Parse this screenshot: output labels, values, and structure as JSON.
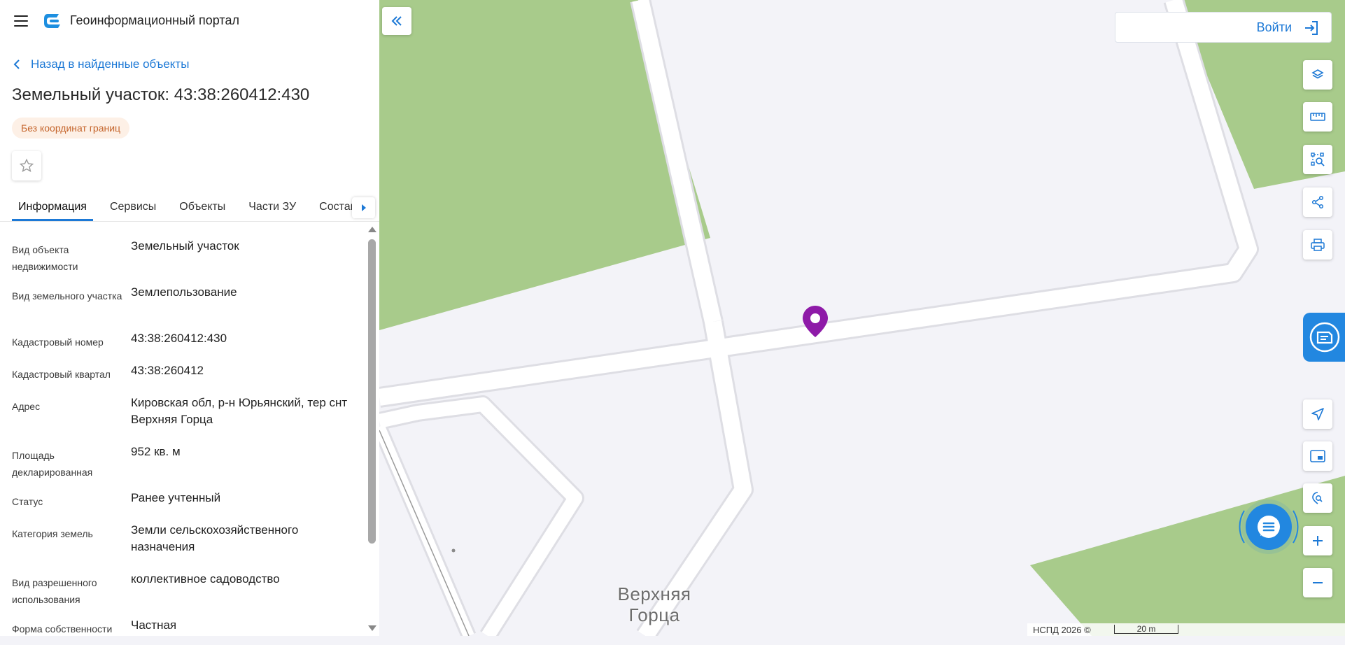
{
  "header": {
    "app_title": "Геоинформационный портал"
  },
  "nav": {
    "back_label": "Назад в найденные объекты"
  },
  "object": {
    "title": "Земельный участок: 43:38:260412:430",
    "badge": "Без координат границ"
  },
  "tabs": [
    {
      "label": "Информация",
      "active": true
    },
    {
      "label": "Сервисы",
      "active": false
    },
    {
      "label": "Объекты",
      "active": false
    },
    {
      "label": "Части ЗУ",
      "active": false
    },
    {
      "label": "Состав",
      "active": false
    }
  ],
  "info": [
    {
      "label": "Вид объекта недвижимости",
      "value": "Земельный участок"
    },
    {
      "label": "Вид земельного участка",
      "value": "Землепользование"
    },
    {
      "label": "Кадастровый номер",
      "value": "43:38:260412:430"
    },
    {
      "label": "Кадастровый квартал",
      "value": "43:38:260412"
    },
    {
      "label": "Адрес",
      "value": "Кировская обл, р-н Юрьянский, тер снт Верхняя Горца"
    },
    {
      "label": "Площадь декларированная",
      "value": "952 кв. м"
    },
    {
      "label": "Статус",
      "value": "Ранее учтенный"
    },
    {
      "label": "Категория земель",
      "value": "Земли сельскохозяйственного назначения"
    },
    {
      "label": "Вид разрешенного использования",
      "value": "коллективное садоводство"
    },
    {
      "label": "Форма собственности",
      "value": "Частная"
    }
  ],
  "map": {
    "login_label": "Войти",
    "place_label_line1": "Верхняя",
    "place_label_line2": "Горца",
    "copyright": "НСПД 2026 ©",
    "scale_label": "20 m",
    "colors": {
      "accent": "#1d79d6",
      "vegetation": "#a8cb8b",
      "background": "#f3f3f8",
      "road": "#ffffff",
      "marker": "#8e1aa8",
      "badge_text": "#c5652c",
      "badge_bg": "#fdf0e6"
    },
    "tools": [
      "layers-icon",
      "ruler-icon",
      "area-search-icon",
      "share-icon",
      "print-icon",
      "navigate-icon",
      "minimap-icon",
      "locate-icon",
      "zoom-in-icon",
      "zoom-out-icon"
    ]
  }
}
